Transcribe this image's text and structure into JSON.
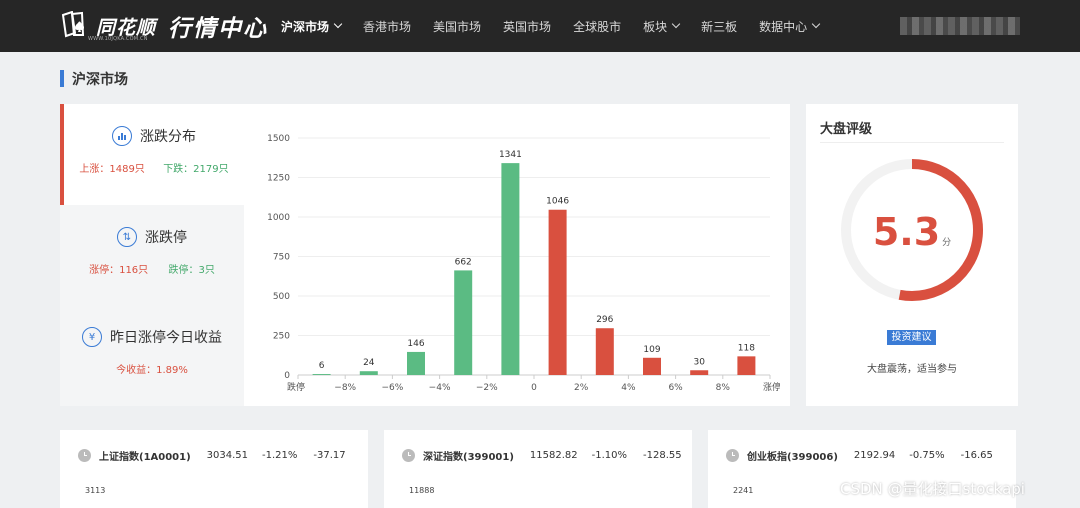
{
  "header": {
    "logo_name": "同花顺",
    "logo_sub": "WWW.10JQKA.COM.CN",
    "title": "行情中心",
    "nav": [
      {
        "label": "沪深市场",
        "dropdown": true,
        "active": true
      },
      {
        "label": "香港市场",
        "dropdown": false,
        "active": false
      },
      {
        "label": "美国市场",
        "dropdown": false,
        "active": false
      },
      {
        "label": "英国市场",
        "dropdown": false,
        "active": false
      },
      {
        "label": "全球股市",
        "dropdown": false,
        "active": false
      },
      {
        "label": "板块",
        "dropdown": true,
        "active": false
      },
      {
        "label": "新三板",
        "dropdown": false,
        "active": false
      },
      {
        "label": "数据中心",
        "dropdown": true,
        "active": false
      }
    ]
  },
  "section": {
    "title": "沪深市场"
  },
  "menu": {
    "items": [
      {
        "title": "涨跌分布",
        "icon": "bar-chart-icon",
        "up_label": "上涨：1489只",
        "down_label": "下跌：2179只"
      },
      {
        "title": "涨跌停",
        "icon": "up-down-arrows-icon",
        "up_label": "涨停：116只",
        "down_label": "跌停：3只"
      },
      {
        "title": "昨日涨停今日收益",
        "icon": "yen-icon",
        "yield_label": "今收益：1.89%"
      }
    ]
  },
  "chart_data": {
    "type": "bar",
    "categories": [
      "跌停",
      "-10%~-8%",
      "-8%~-6%",
      "-6%~-4%",
      "-4%~-2%",
      "-2%~0",
      "0~2%",
      "2%~4%",
      "4%~6%",
      "6%~8%",
      "8%~涨停",
      "涨停"
    ],
    "values": [
      6,
      24,
      146,
      662,
      1341,
      1046,
      296,
      109,
      30,
      118
    ],
    "bars": [
      {
        "value": 6,
        "color": "#5bbb83"
      },
      {
        "value": 24,
        "color": "#5bbb83"
      },
      {
        "value": 146,
        "color": "#5bbb83"
      },
      {
        "value": 662,
        "color": "#5bbb83"
      },
      {
        "value": 1341,
        "color": "#5bbb83"
      },
      {
        "value": 1046,
        "color": "#d9503f"
      },
      {
        "value": 296,
        "color": "#d9503f"
      },
      {
        "value": 109,
        "color": "#d9503f"
      },
      {
        "value": 30,
        "color": "#d9503f"
      },
      {
        "value": 118,
        "color": "#d9503f"
      }
    ],
    "x_tick_labels": [
      "跌停",
      "−8%",
      "−6%",
      "−4%",
      "−2%",
      "0",
      "2%",
      "4%",
      "6%",
      "8%",
      "涨停"
    ],
    "y_ticks": [
      0,
      250,
      500,
      750,
      1000,
      1250,
      1500
    ],
    "ylim": [
      0,
      1500
    ],
    "grid": true
  },
  "rating": {
    "title": "大盘评级",
    "score": "5.3",
    "score_value": 5.3,
    "score_max": 10,
    "unit": "分",
    "advice_badge": "投资建议",
    "advice_text": "大盘震荡，适当参与",
    "arc_color": "#d9503f"
  },
  "indices": [
    {
      "name": "上证指数(1A0001)",
      "value": "3034.51",
      "pct": "-1.21%",
      "change": "-37.17",
      "base": "3113"
    },
    {
      "name": "深证指数(399001)",
      "value": "11582.82",
      "pct": "-1.10%",
      "change": "-128.55",
      "base": "11888"
    },
    {
      "name": "创业板指(399006)",
      "value": "2192.94",
      "pct": "-0.75%",
      "change": "-16.65",
      "base": "2241"
    }
  ],
  "watermark": "CSDN @量化接口stockapi"
}
